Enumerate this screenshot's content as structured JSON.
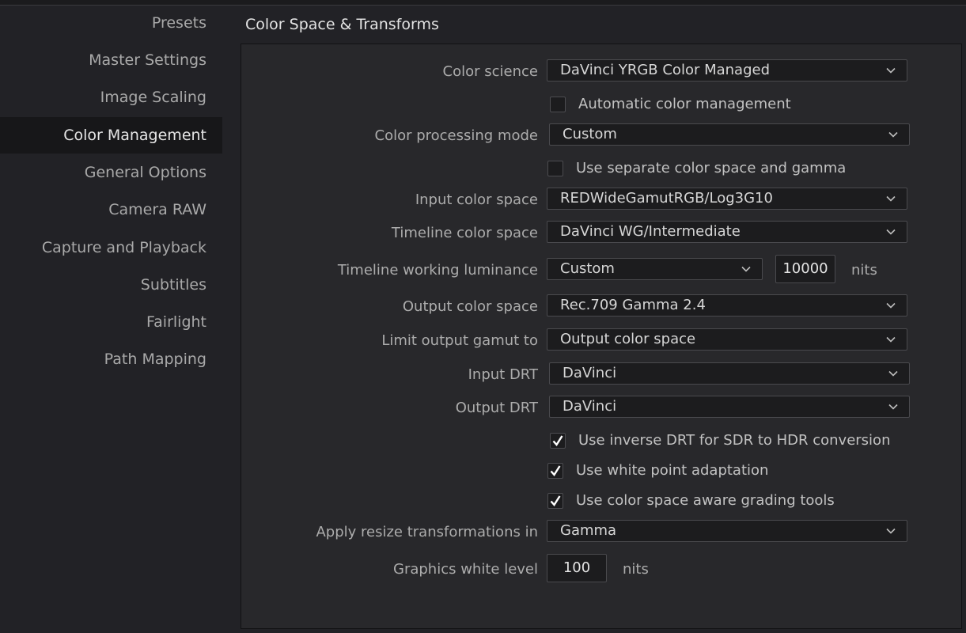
{
  "sidebar": {
    "items": [
      {
        "label": "Presets",
        "active": false
      },
      {
        "label": "Master Settings",
        "active": false
      },
      {
        "label": "Image Scaling",
        "active": false
      },
      {
        "label": "Color Management",
        "active": true
      },
      {
        "label": "General Options",
        "active": false
      },
      {
        "label": "Camera RAW",
        "active": false
      },
      {
        "label": "Capture and Playback",
        "active": false
      },
      {
        "label": "Subtitles",
        "active": false
      },
      {
        "label": "Fairlight",
        "active": false
      },
      {
        "label": "Path Mapping",
        "active": false
      }
    ]
  },
  "section": {
    "title": "Color Space & Transforms"
  },
  "form": {
    "color_science": {
      "label": "Color science",
      "value": "DaVinci YRGB Color Managed"
    },
    "auto_color_mgmt": {
      "label": "Automatic color management",
      "checked": false
    },
    "processing_mode": {
      "label": "Color processing mode",
      "value": "Custom"
    },
    "separate_cs_gamma": {
      "label": "Use separate color space and gamma",
      "checked": false
    },
    "input_cs": {
      "label": "Input color space",
      "value": "REDWideGamutRGB/Log3G10"
    },
    "timeline_cs": {
      "label": "Timeline color space",
      "value": "DaVinci WG/Intermediate"
    },
    "timeline_lum": {
      "label": "Timeline working luminance",
      "value": "Custom",
      "nits_value": "10000",
      "unit": "nits"
    },
    "output_cs": {
      "label": "Output color space",
      "value": "Rec.709 Gamma 2.4"
    },
    "limit_gamut": {
      "label": "Limit output gamut to",
      "value": "Output color space"
    },
    "input_drt": {
      "label": "Input DRT",
      "value": "DaVinci"
    },
    "output_drt": {
      "label": "Output DRT",
      "value": "DaVinci"
    },
    "inverse_drt": {
      "label": "Use inverse DRT for SDR to HDR conversion",
      "checked": true
    },
    "white_point": {
      "label": "Use white point adaptation",
      "checked": true
    },
    "cs_aware_tools": {
      "label": "Use color space aware grading tools",
      "checked": true
    },
    "resize_in": {
      "label": "Apply resize transformations in",
      "value": "Gamma"
    },
    "graphics_white": {
      "label": "Graphics white level",
      "value": "100",
      "unit": "nits"
    }
  },
  "icons": {
    "dropdown": "chevron-down-icon",
    "check": "check-icon"
  },
  "colors": {
    "background": "#222226",
    "panel": "#28282b",
    "active_nav": "#171719",
    "field": "#1c1c1e"
  }
}
